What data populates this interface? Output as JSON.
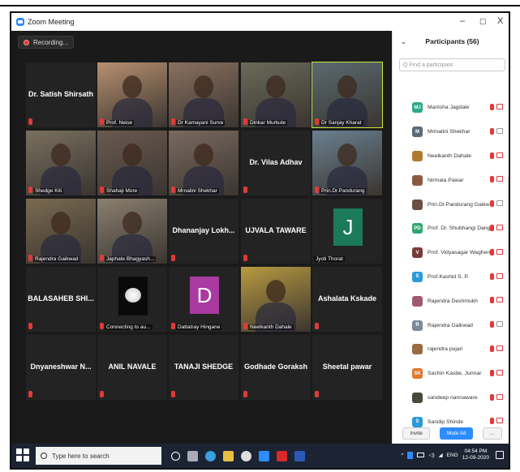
{
  "window": {
    "title": "Zoom Meeting",
    "controls": [
      "–",
      "▢",
      "X"
    ]
  },
  "recording": {
    "label": "Recording..."
  },
  "tiles": [
    {
      "name": "Dr. Satish Shirsath",
      "label": "",
      "type": "name"
    },
    {
      "name": "",
      "label": "Prof. Neise",
      "type": "video",
      "color": "#b89070"
    },
    {
      "name": "",
      "label": "Dr Kamayani Surve",
      "type": "video",
      "color": "#8a7060"
    },
    {
      "name": "",
      "label": "Dinkar Murkute",
      "type": "video",
      "color": "#6a6a5a"
    },
    {
      "name": "",
      "label": "Dr Sanjay Kharat",
      "type": "video",
      "color": "#5a6a70",
      "active": true
    },
    {
      "name": "",
      "label": "Shedge Kiti",
      "type": "video",
      "color": "#7a7060"
    },
    {
      "name": "",
      "label": "Shahaji More",
      "type": "video",
      "color": "#6a5a50"
    },
    {
      "name": "",
      "label": "Mrnalini Shekhar",
      "type": "video",
      "color": "#7a6a60"
    },
    {
      "name": "Dr. Vilas Adhav",
      "label": "",
      "type": "name"
    },
    {
      "name": "",
      "label": "Prin.Dr.Pandurang",
      "type": "video",
      "color": "#6a8090"
    },
    {
      "name": "",
      "label": "Rajendra Gaikwad",
      "type": "video",
      "color": "#7a6a50"
    },
    {
      "name": "",
      "label": "Japhate Bhagyash...",
      "type": "video",
      "color": "#8a8070"
    },
    {
      "name": "Dhananjay  Lokh...",
      "label": "",
      "type": "name"
    },
    {
      "name": "UJVALA TAWARE",
      "label": "",
      "type": "name"
    },
    {
      "name": "",
      "label": "Jyoti Thorat",
      "type": "avatar",
      "letter": "J",
      "color": "#1b7a5a"
    },
    {
      "name": "BALASAHEB  SHI...",
      "label": "",
      "type": "name"
    },
    {
      "name": "",
      "label": "Connecting to au...",
      "type": "flower"
    },
    {
      "name": "",
      "label": "Dattatray Hingane",
      "type": "avatar",
      "letter": "D",
      "color": "#a83aa0"
    },
    {
      "name": "",
      "label": "Neelkanth Dahale",
      "type": "video",
      "color": "#b89a40"
    },
    {
      "name": "Ashalata Kskade",
      "label": "",
      "type": "name"
    },
    {
      "name": "Dnyaneshwar  N...",
      "label": "",
      "type": "name"
    },
    {
      "name": "ANIL NAVALE",
      "label": "",
      "type": "name"
    },
    {
      "name": "TANAJI SHEDGE",
      "label": "",
      "type": "name"
    },
    {
      "name": "Godhade Goraksh",
      "label": "",
      "type": "name"
    },
    {
      "name": "Sheetal pawar",
      "label": "",
      "type": "name"
    }
  ],
  "participants": {
    "title": "Participants (56)",
    "search_placeholder": "Q Find a participant",
    "list": [
      {
        "initials": "MJ",
        "name": "Manisha Jagdale",
        "color": "#2da888",
        "cam_off": false
      },
      {
        "initials": "M",
        "name": "Mrinalini Shekhar",
        "color": "#5a6a78",
        "cam_off": true
      },
      {
        "initials": "",
        "name": "Neelkanth Dahale",
        "color": "#b07a30",
        "cam_off": false
      },
      {
        "initials": "",
        "name": "Nirmala Pawar",
        "color": "#8a5a40",
        "cam_off": false
      },
      {
        "initials": "",
        "name": "Prin.Dr.Pandurang Gaikwad",
        "color": "#6a5040",
        "cam_off": true
      },
      {
        "initials": "PD",
        "name": "Prof. Dr. Shubhangi Dangat",
        "color": "#2da870",
        "cam_off": false
      },
      {
        "initials": "V",
        "name": "Prof. Vidyasagar Waghere",
        "color": "#7a3a3a",
        "cam_off": false
      },
      {
        "initials": "S",
        "name": "Prof.Kashid S. P.",
        "color": "#2a9ad8",
        "cam_off": false
      },
      {
        "initials": "",
        "name": "Rajendra Deshmukh",
        "color": "#a05a70",
        "cam_off": false
      },
      {
        "initials": "R",
        "name": "Rajendra Gaikwad",
        "color": "#7a8a98",
        "cam_off": true
      },
      {
        "initials": "",
        "name": "rajendra pujari",
        "color": "#9a6a40",
        "cam_off": false
      },
      {
        "initials": "SK",
        "name": "Sachin Kasbe, Junnar",
        "color": "#e07830",
        "cam_off": false
      },
      {
        "initials": "",
        "name": "sandeep nannaware",
        "color": "#4a4a3a",
        "cam_off": false
      },
      {
        "initials": "S",
        "name": "Sandip Shinde",
        "color": "#2a9ad8",
        "cam_off": false
      }
    ],
    "invite": "Invite",
    "mute_all": "Mute All",
    "more": "..."
  },
  "taskbar": {
    "search_placeholder": "Type here to search",
    "time": "04:54 PM",
    "date": "12-09-2020",
    "lang": "ENG"
  }
}
